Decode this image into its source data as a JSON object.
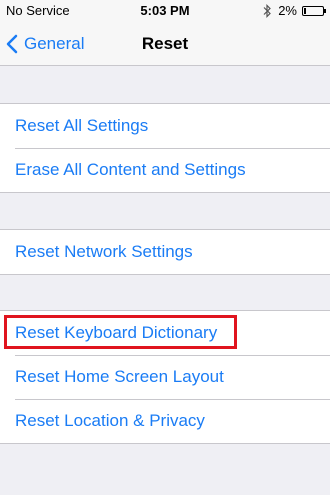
{
  "status_bar": {
    "carrier": "No Service",
    "time": "5:03 PM",
    "battery_percent": "2%",
    "icons": [
      "bluetooth-icon",
      "battery-icon"
    ]
  },
  "nav": {
    "back_label": "General",
    "title": "Reset"
  },
  "groups": [
    {
      "items": [
        {
          "label": "Reset All Settings"
        },
        {
          "label": "Erase All Content and Settings"
        }
      ]
    },
    {
      "items": [
        {
          "label": "Reset Network Settings"
        }
      ]
    },
    {
      "items": [
        {
          "label": "Reset Keyboard Dictionary",
          "highlighted": true
        },
        {
          "label": "Reset Home Screen Layout"
        },
        {
          "label": "Reset Location & Privacy"
        }
      ]
    }
  ],
  "colors": {
    "accent": "#1a7cf5",
    "background": "#efeff4",
    "highlight": "#e0141e"
  }
}
